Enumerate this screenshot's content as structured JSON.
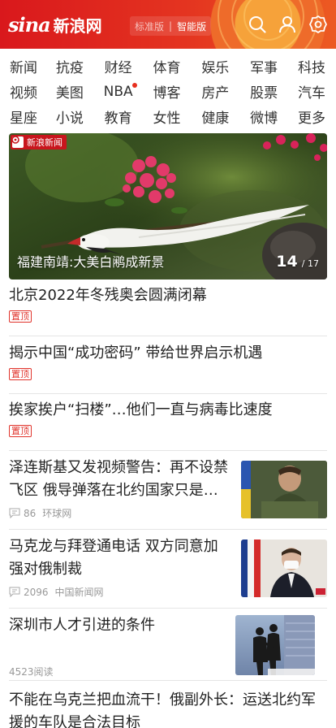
{
  "header": {
    "logo_en": "sina",
    "logo_cn": "新浪网",
    "version_standard": "标准版",
    "version_separator": "|",
    "version_smart": "智能版",
    "icons": [
      "search-icon",
      "user-icon",
      "settings-icon"
    ],
    "brand_color": "#e43420"
  },
  "categories": [
    [
      "新闻",
      "抗疫",
      "财经",
      "体育",
      "娱乐",
      "军事",
      "科技"
    ],
    [
      "视频",
      "美图",
      "NBA",
      "博客",
      "房产",
      "股票",
      "汽车"
    ],
    [
      "星座",
      "小说",
      "教育",
      "女性",
      "健康",
      "微博",
      "更多"
    ]
  ],
  "hero": {
    "tag": "新浪新闻",
    "caption": "福建南靖:大美白鹇成新景",
    "current": "14",
    "total": "/ 17"
  },
  "news": [
    {
      "title": "北京2022年冬残奥会圆满闭幕",
      "badge": "置顶"
    },
    {
      "title": "揭示中国“成功密码” 带给世界启示机遇",
      "badge": "置顶"
    },
    {
      "title": "挨家挨户“扫楼”…他们一直与病毒比速度",
      "badge": "置顶"
    },
    {
      "title": "泽连斯基又发视频警告：再不设禁飞区 俄导弹落在北约国家只是…",
      "comments": "86",
      "source": "环球网"
    },
    {
      "title": "马克龙与拜登通电话 双方同意加强对俄制裁",
      "comments": "2096",
      "source": "中国新闻网"
    },
    {
      "title": "深圳市人才引进的条件",
      "reads": "4523阅读"
    },
    {
      "title": "不能在乌克兰把血流干！俄副外长：运送北约军援的车队是合法目标"
    }
  ]
}
